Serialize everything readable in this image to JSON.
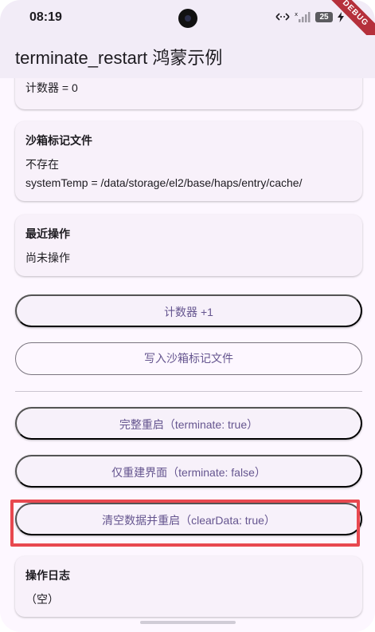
{
  "status_bar": {
    "time": "08:19",
    "battery": "25"
  },
  "debug_ribbon": "DEBUG",
  "app_bar": {
    "title": "terminate_restart 鸿蒙示例"
  },
  "counter_card": {
    "line": "计数器 = 0"
  },
  "sandbox_card": {
    "title": "沙箱标记文件",
    "status": "不存在",
    "path": "systemTemp = /data/storage/el2/base/haps/entry/cache/"
  },
  "recent_card": {
    "title": "最近操作",
    "value": "尚未操作"
  },
  "buttons": {
    "increment": "计数器 +1",
    "write_marker": "写入沙箱标记文件",
    "full_restart": "完整重启（terminate: true）",
    "rebuild_ui": "仅重建界面（terminate: false）",
    "clear_restart": "清空数据并重启（clearData: true）"
  },
  "log_card": {
    "title": "操作日志",
    "value": "（空）"
  },
  "colors": {
    "accent": "#65558f",
    "highlight": "#e8484f",
    "surface": "#fdf7ff"
  }
}
